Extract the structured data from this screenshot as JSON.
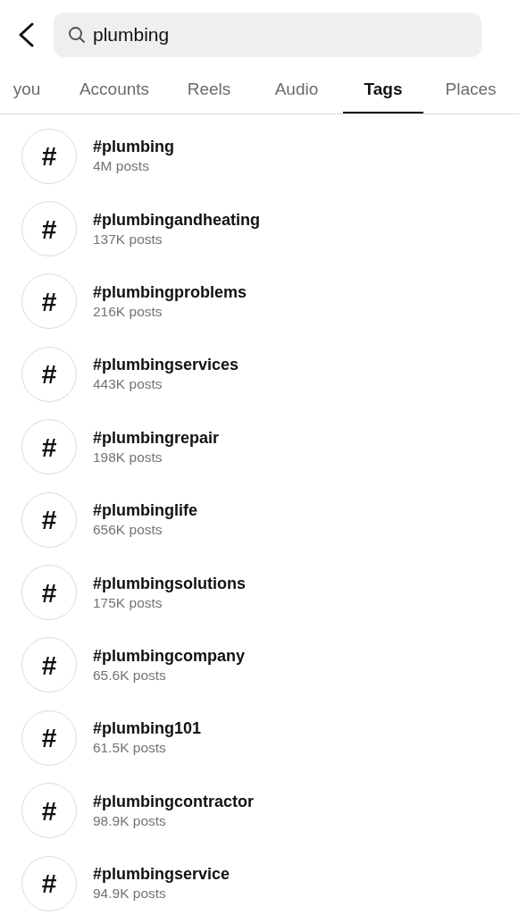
{
  "search": {
    "value": "plumbing"
  },
  "tabs": [
    {
      "label": "you",
      "selected": false
    },
    {
      "label": "Accounts",
      "selected": false
    },
    {
      "label": "Reels",
      "selected": false
    },
    {
      "label": "Audio",
      "selected": false
    },
    {
      "label": "Tags",
      "selected": true
    },
    {
      "label": "Places",
      "selected": false
    }
  ],
  "results": [
    {
      "icon": "#",
      "tag": "#plumbing",
      "posts": "4M posts"
    },
    {
      "icon": "#",
      "tag": "#plumbingandheating",
      "posts": "137K posts"
    },
    {
      "icon": "#",
      "tag": "#plumbingproblems",
      "posts": "216K posts"
    },
    {
      "icon": "#",
      "tag": "#plumbingservices",
      "posts": "443K posts"
    },
    {
      "icon": "#",
      "tag": "#plumbingrepair",
      "posts": "198K posts"
    },
    {
      "icon": "#",
      "tag": "#plumbinglife",
      "posts": "656K posts"
    },
    {
      "icon": "#",
      "tag": "#plumbingsolutions",
      "posts": "175K posts"
    },
    {
      "icon": "#",
      "tag": "#plumbingcompany",
      "posts": "65.6K posts"
    },
    {
      "icon": "#",
      "tag": "#plumbing101",
      "posts": "61.5K posts"
    },
    {
      "icon": "#",
      "tag": "#plumbingcontractor",
      "posts": "98.9K posts"
    },
    {
      "icon": "#",
      "tag": "#plumbingservice",
      "posts": "94.9K posts"
    }
  ]
}
